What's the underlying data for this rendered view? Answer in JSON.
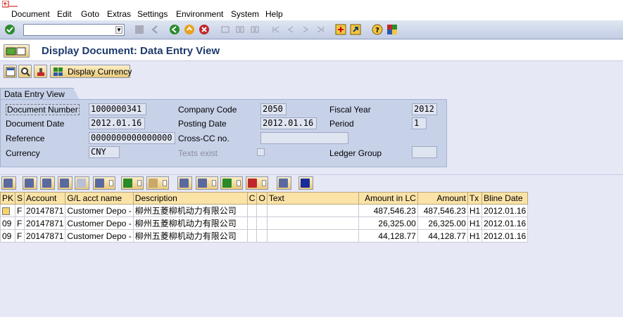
{
  "menu": {
    "items": [
      "Document",
      "Edit",
      "Goto",
      "Extras",
      "Settings",
      "Environment",
      "System",
      "Help"
    ]
  },
  "toolbar": {
    "command_value": "",
    "icons": [
      "enter-icon",
      "back-icon",
      "exit-icon",
      "cancel-icon",
      "print-icon",
      "find-icon",
      "find-next-icon",
      "first-page-icon",
      "prev-page-icon",
      "next-page-icon",
      "last-page-icon",
      "create-session-icon",
      "shortcut-icon",
      "help-icon",
      "layout-icon"
    ]
  },
  "title": "Display Document: Data Entry View",
  "app_toolbar": {
    "display_currency_label": "Display Currency"
  },
  "header_group": {
    "tab_label": "Data Entry View",
    "document_number_label": "Document Number",
    "document_number": "1000000341",
    "company_code_label": "Company Code",
    "company_code": "2050",
    "fiscal_year_label": "Fiscal Year",
    "fiscal_year": "2012",
    "document_date_label": "Document Date",
    "document_date": "2012.01.16",
    "posting_date_label": "Posting Date",
    "posting_date": "2012.01.16",
    "period_label": "Period",
    "period": "1",
    "reference_label": "Reference",
    "reference": "0000000000000000",
    "cross_cc_label": "Cross-CC no.",
    "cross_cc": "",
    "currency_label": "Currency",
    "currency": "CNY",
    "texts_exist_label": "Texts exist",
    "ledger_group_label": "Ledger Group",
    "ledger_group": ""
  },
  "grid": {
    "columns": [
      "PK",
      "S",
      "Account",
      "G/L acct name",
      "Description",
      "C",
      "O",
      "Text",
      "Amount in LC",
      "Amount",
      "Tx",
      "Bline Date"
    ],
    "rows": [
      {
        "pk": "",
        "s": "F",
        "account": "20147871",
        "gl_name": "Customer Depo -",
        "description": "柳州五菱柳机动力有限公司",
        "c": "",
        "o": "",
        "text": "",
        "amount_lc": "487,546.23",
        "amount": "487,546.23",
        "tx": "H1",
        "bline": "2012.01.16"
      },
      {
        "pk": "09",
        "s": "F",
        "account": "20147871",
        "gl_name": "Customer Depo -",
        "description": "柳州五菱柳机动力有限公司",
        "c": "",
        "o": "",
        "text": "",
        "amount_lc": "26,325.00",
        "amount": "26,325.00",
        "tx": "H1",
        "bline": "2012.01.16"
      },
      {
        "pk": "09",
        "s": "F",
        "account": "20147871",
        "gl_name": "Customer Depo -",
        "description": "柳州五菱柳机动力有限公司",
        "c": "",
        "o": "",
        "text": "",
        "amount_lc": "44,128.77",
        "amount": "44,128.77",
        "tx": "H1",
        "bline": "2012.01.16"
      }
    ]
  },
  "colors": {
    "title": "#1d3a6c",
    "background": "#e6e8f6",
    "group_bg": "#c7d1e8",
    "grid_header": "#fbe3a7"
  }
}
